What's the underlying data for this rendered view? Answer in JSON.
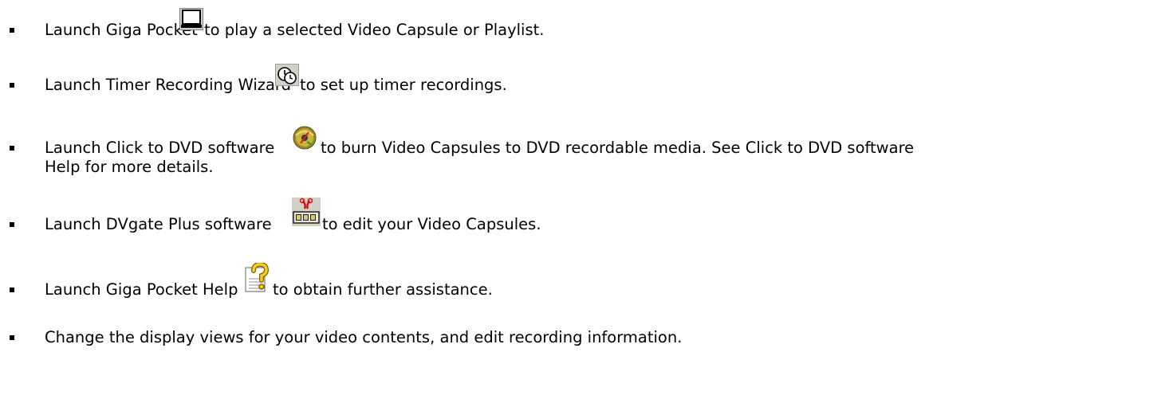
{
  "items": [
    {
      "pre": "Launch Giga Pocket ",
      "icon": "giga-pocket-player-icon",
      "post": "to play a selected Video Capsule or Playlist."
    },
    {
      "pre": "Launch Timer Recording Wizard ",
      "icon": "timer-recording-wizard-icon",
      "post": "to set up timer recordings."
    },
    {
      "pre": "Launch Click to DVD   software ",
      "icon": "click-to-dvd-icon",
      "post": "to burn Video Capsules to DVD recordable media. See Click to DVD software",
      "continuation": "Help for more details."
    },
    {
      "pre": "Launch DVgate   Plus software ",
      "icon": "dvgate-plus-icon",
      "post": "to edit your Video Capsules."
    },
    {
      "pre": "Launch Giga Pocket Help ",
      "icon": "giga-pocket-help-icon",
      "post": "to obtain further assistance."
    },
    {
      "text": "Change the display views for your video contents, and edit recording information."
    }
  ]
}
